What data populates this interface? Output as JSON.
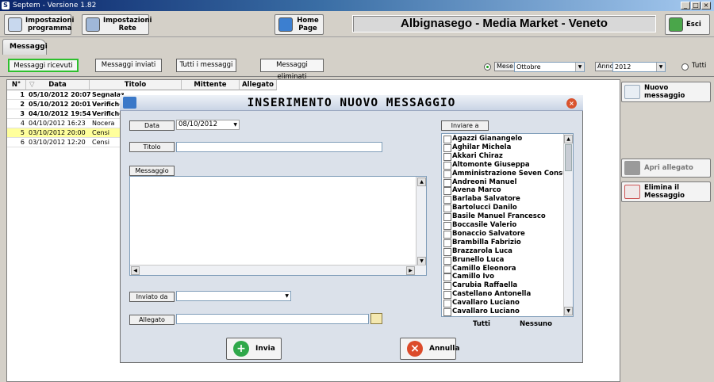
{
  "window": {
    "title": "Septem - Versione 1.82",
    "min": "_",
    "max": "□",
    "close": "×"
  },
  "toolbar": {
    "impostazioni_programma": "Impostazioni programma",
    "impostazioni_rete": "Impostazioni Rete",
    "home_page": "Home Page",
    "store_name": "Albignasego - Media Market - Veneto",
    "esci": "Esci"
  },
  "tabs": {
    "messaggi": "Messaggi"
  },
  "filters": {
    "ricevuti": "Messaggi ricevuti",
    "inviati": "Messaggi inviati",
    "tutti": "Tutti i messaggi",
    "eliminati": "Messaggi eliminati",
    "mese_label": "Mese",
    "mese_value": "Ottobre",
    "anno_label": "Anno",
    "anno_value": "2012",
    "tutti_radio": "Tutti"
  },
  "grid": {
    "headers": [
      "N°",
      "Data",
      "Titolo",
      "Mittente",
      "Allegato"
    ],
    "rows": [
      {
        "n": "1",
        "data": "05/10/2012 20:07",
        "titolo": "Segnalazi",
        "unread": true,
        "hl": false
      },
      {
        "n": "2",
        "data": "05/10/2012 20:01",
        "titolo": "Verifiche",
        "unread": true,
        "hl": false
      },
      {
        "n": "3",
        "data": "04/10/2012 19:54",
        "titolo": "Verifiche",
        "unread": true,
        "hl": false
      },
      {
        "n": "4",
        "data": "04/10/2012 16:23",
        "titolo": "Nocera",
        "unread": false,
        "hl": false
      },
      {
        "n": "5",
        "data": "03/10/2012 20:00",
        "titolo": "Censi",
        "unread": false,
        "hl": true
      },
      {
        "n": "6",
        "data": "03/10/2012 12:20",
        "titolo": "Censi",
        "unread": false,
        "hl": false
      }
    ]
  },
  "side": {
    "nuovo": "Nuovo messaggio",
    "apri": "Apri allegato",
    "elimina": "Elimina il Messaggio"
  },
  "dialog": {
    "title": "INSERIMENTO NUOVO MESSAGGIO",
    "data_label": "Data",
    "data_value": "08/10/2012",
    "titolo_label": "Titolo",
    "messaggio_label": "Messaggio",
    "inviato_da_label": "Inviato da",
    "allegato_label": "Allegato",
    "inviare_a_label": "Inviare a",
    "tutti": "Tutti",
    "nessuno": "Nessuno",
    "invia": "Invia",
    "annulla": "Annulla",
    "recipients": [
      "Agazzi Gianangelo",
      "Aghilar Michela",
      "Akkari Chiraz",
      "Altomonte Giuseppa",
      "Amministrazione Seven Consulting",
      "Andreoni Manuel",
      "Avena Marco",
      "Barlaba Salvatore",
      "Bartolucci Danilo",
      "Basile Manuel Francesco",
      "Boccasile Valerio",
      "Bonaccio Salvatore",
      "Brambilla Fabrizio",
      "Brazzarola Luca",
      "Brunello Luca",
      "Camillo Eleonora",
      "Camillo Ivo",
      "Carubia Raffaella",
      "Castellano Antonella",
      "Cavallaro Luciano",
      "Cavallaro Luciano"
    ]
  }
}
